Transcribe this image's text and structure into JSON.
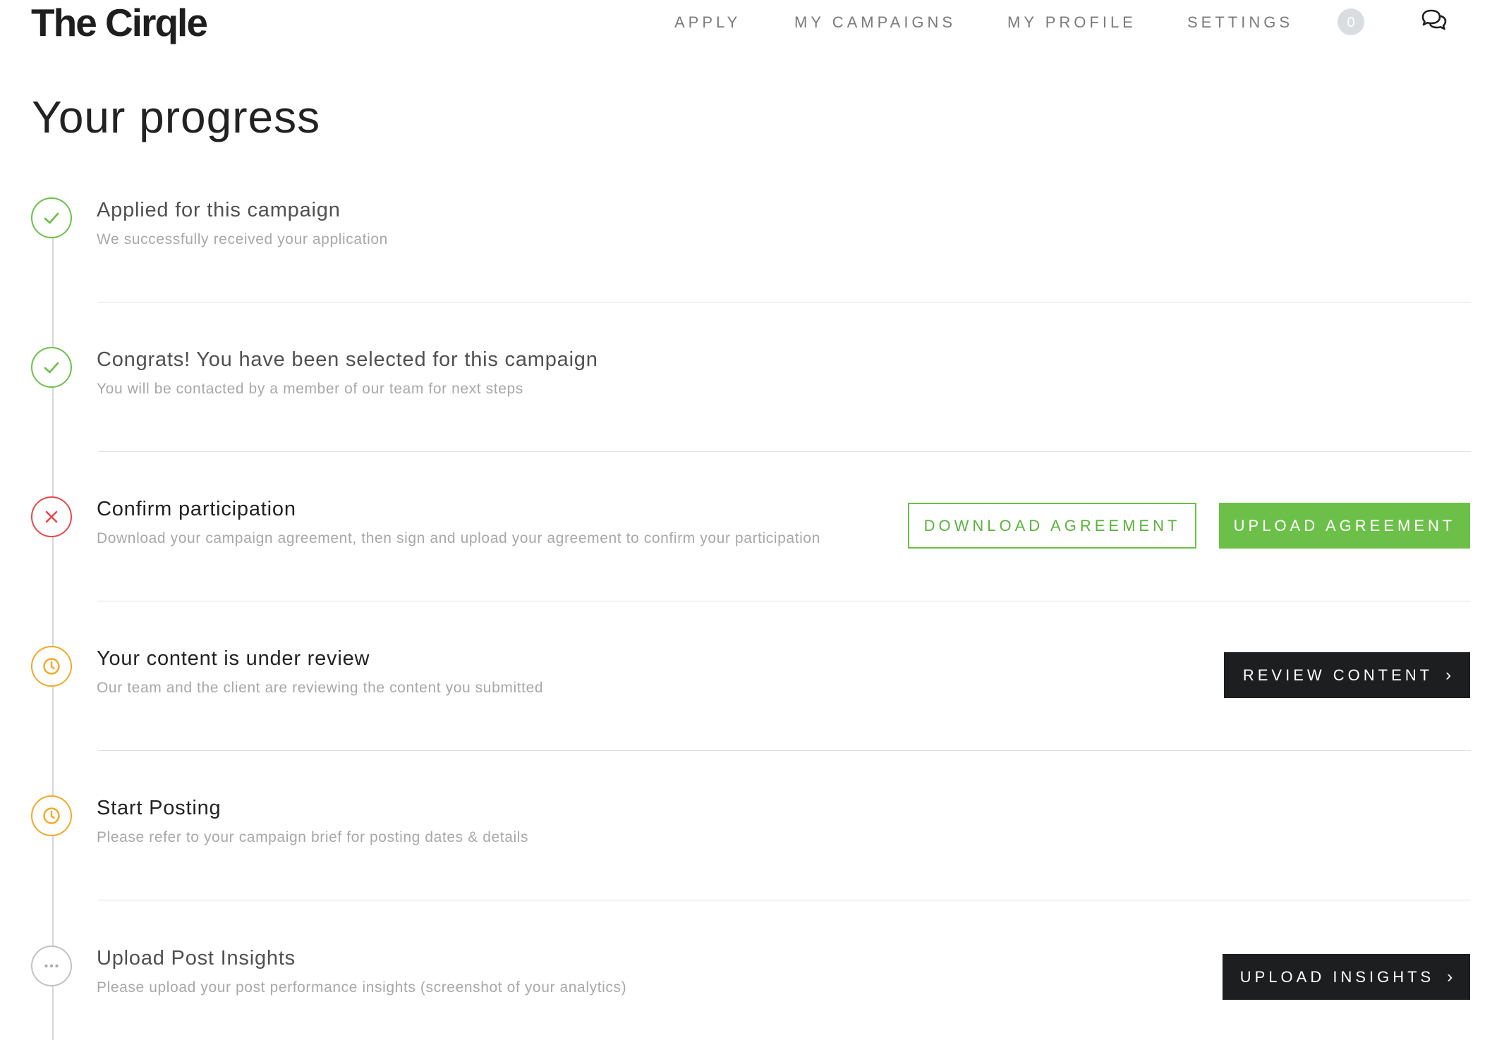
{
  "header": {
    "logo": "The Cirqle",
    "nav": [
      {
        "label": "APPLY"
      },
      {
        "label": "MY CAMPAIGNS"
      },
      {
        "label": "MY PROFILE"
      },
      {
        "label": "SETTINGS"
      }
    ],
    "notification_count": "0",
    "chat_icon": "chat-bubbles-icon"
  },
  "page": {
    "title": "Your progress"
  },
  "colors": {
    "done": "#6cc04a",
    "error": "#e8474a",
    "pending": "#f3a726",
    "idle": "#bfc3c6",
    "dark_button": "#1d1e1f"
  },
  "steps": [
    {
      "status": "done",
      "icon": "check-icon",
      "title": "Applied for this campaign",
      "description": "We successfully received your application"
    },
    {
      "status": "done",
      "icon": "check-icon",
      "title": "Congrats! You have been selected for this campaign",
      "description": "You will be contacted by a member of our team for next steps"
    },
    {
      "status": "error",
      "icon": "x-icon",
      "title": "Confirm participation",
      "description": "Download your campaign agreement, then sign and upload your agreement to confirm your participation",
      "actions": {
        "download_label": "DOWNLOAD AGREEMENT",
        "upload_label": "UPLOAD AGREEMENT"
      }
    },
    {
      "status": "pending",
      "icon": "clock-icon",
      "title": "Your content is under review",
      "description": "Our team and the client are reviewing the content you submitted",
      "actions": {
        "review_label": "REVIEW CONTENT"
      }
    },
    {
      "status": "pending",
      "icon": "clock-icon",
      "title": "Start Posting",
      "description": "Please refer to your campaign brief for posting dates & details"
    },
    {
      "status": "idle",
      "icon": "ellipsis-icon",
      "title": "Upload Post Insights",
      "description": "Please upload your post performance insights (screenshot of your analytics)",
      "actions": {
        "upload_insights_label": "UPLOAD INSIGHTS"
      }
    }
  ]
}
